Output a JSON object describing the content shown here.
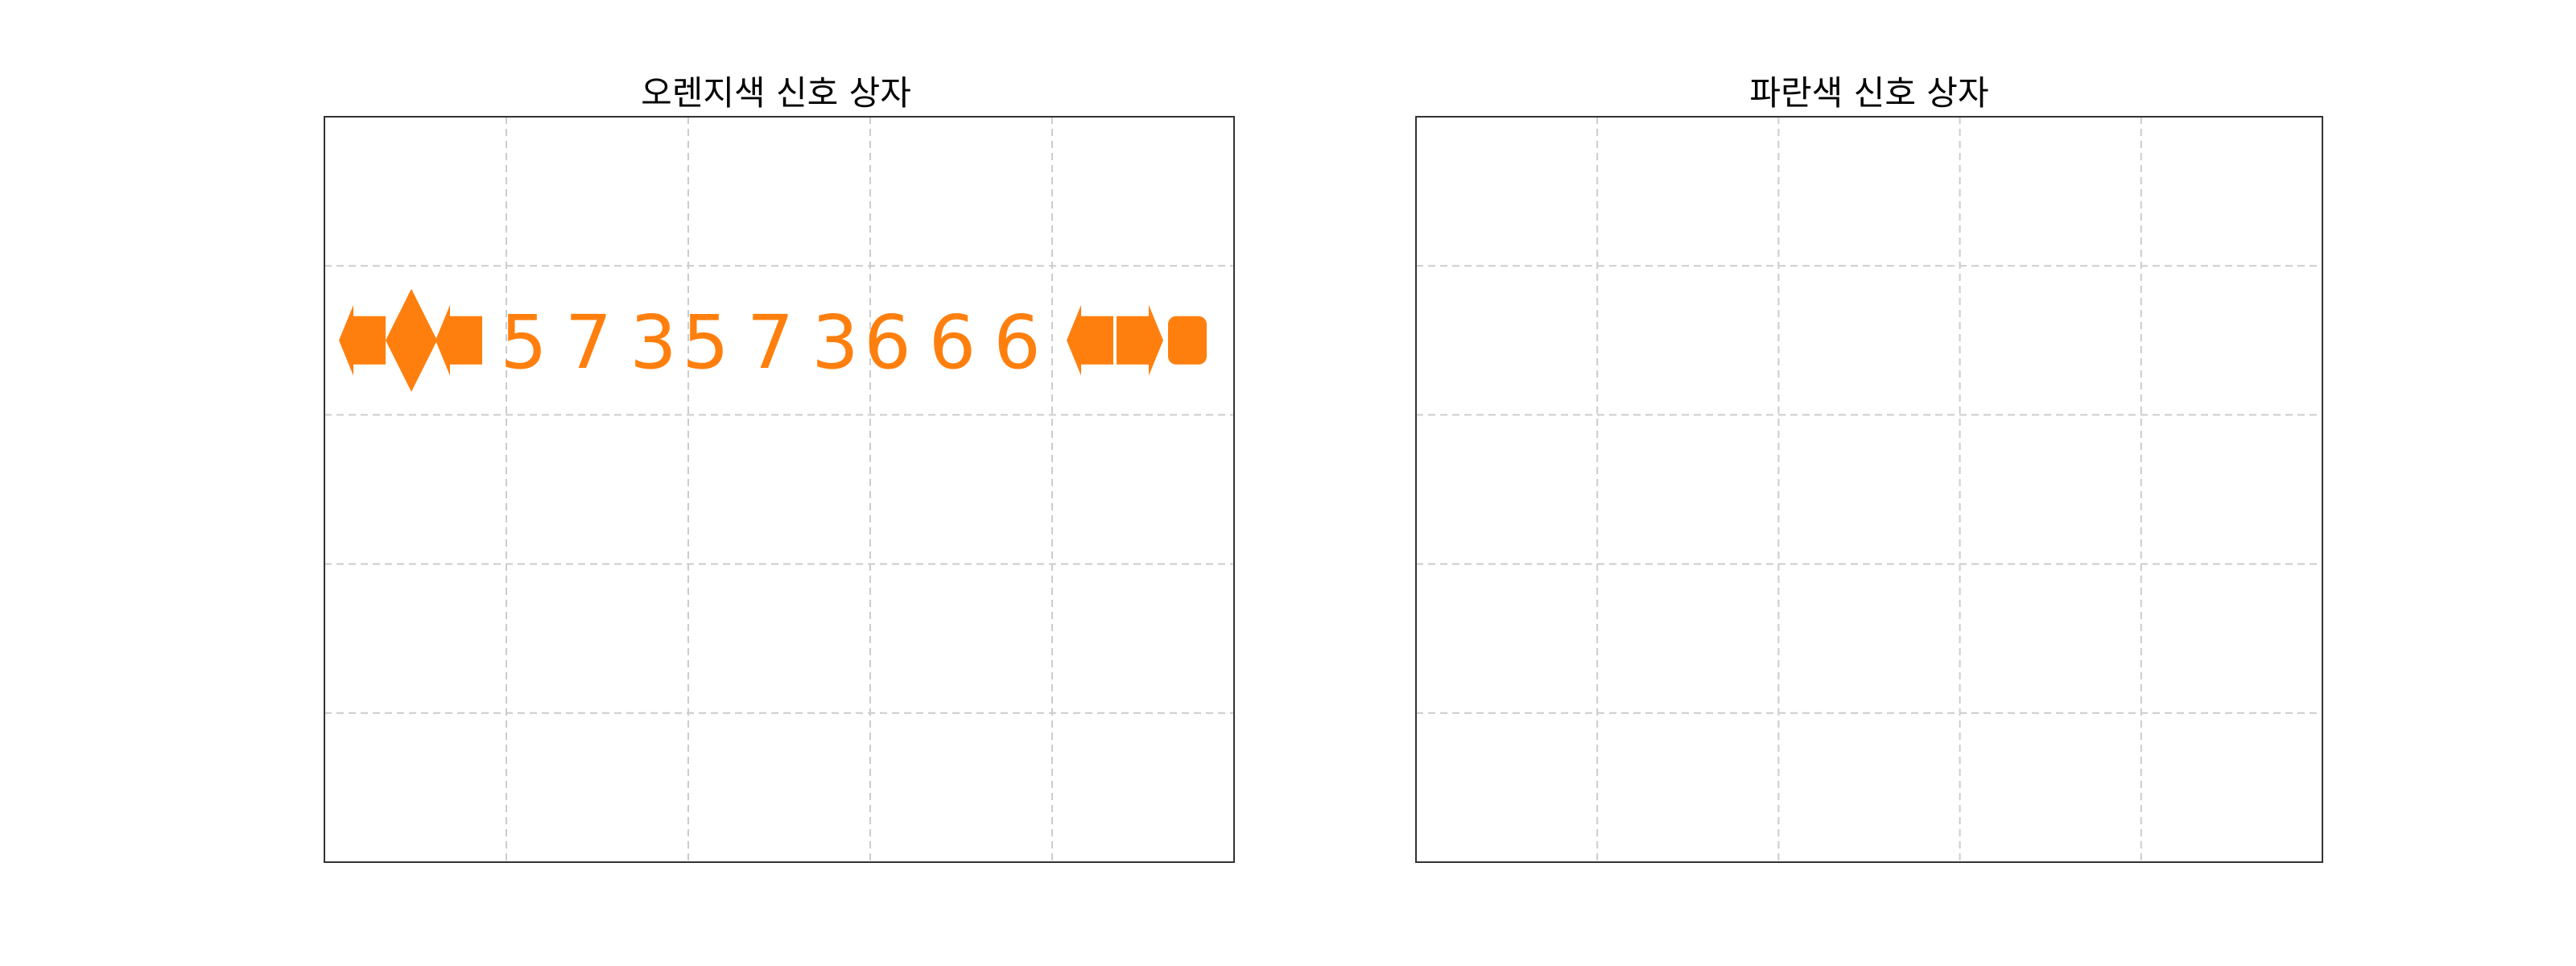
{
  "panels": [
    {
      "title": "오렌지색 신호 상자",
      "color": "#ff7f0e",
      "grid": {
        "columns": 5,
        "rows": 5,
        "style": "dashed",
        "color": "#cccccc"
      },
      "signal_row": 1,
      "left_icons": [
        "arrow-left-icon",
        "diamond-icon",
        "arrow-left-icon"
      ],
      "digit_groups": [
        "573",
        "573",
        "666"
      ],
      "right_icons": [
        "arrow-left-icon",
        "arrow-right-icon",
        "rounded-square-icon"
      ]
    },
    {
      "title": "파란색 신호 상자",
      "color": "#1f77b4",
      "grid": {
        "columns": 5,
        "rows": 5,
        "style": "dashed",
        "color": "#cccccc"
      },
      "signal_row": null,
      "left_icons": [],
      "digit_groups": [],
      "right_icons": []
    }
  ]
}
